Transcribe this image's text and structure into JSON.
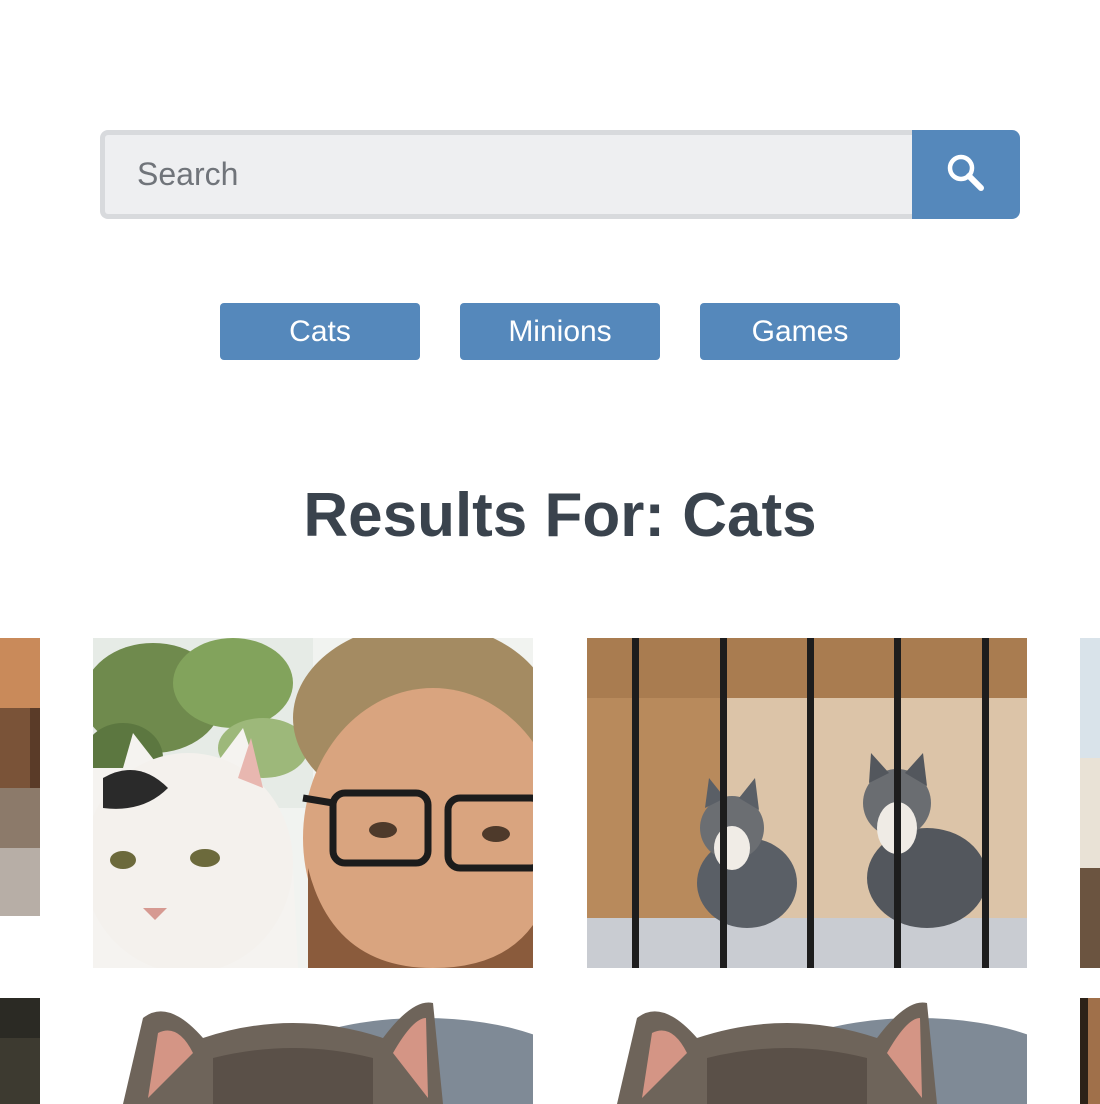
{
  "search": {
    "placeholder": "Search",
    "button_icon": "search-icon"
  },
  "categories": [
    {
      "label": "Cats"
    },
    {
      "label": "Minions"
    },
    {
      "label": "Games"
    }
  ],
  "results": {
    "heading": "Results For: Cats"
  },
  "images": [
    {
      "subject": "partial-cat-photo-left"
    },
    {
      "subject": "man-with-white-cat"
    },
    {
      "subject": "two-kittens-behind-bars"
    },
    {
      "subject": "partial-photo-right"
    },
    {
      "subject": "partial-photo-bottom-left"
    },
    {
      "subject": "tabby-cat-ears"
    },
    {
      "subject": "tabby-cat-ears"
    },
    {
      "subject": "partial-photo-bottom-right"
    }
  ],
  "colors": {
    "accent": "#5588bb",
    "heading": "#3a434d",
    "input_bg": "#eeeff1",
    "input_border": "#d8dadd"
  }
}
